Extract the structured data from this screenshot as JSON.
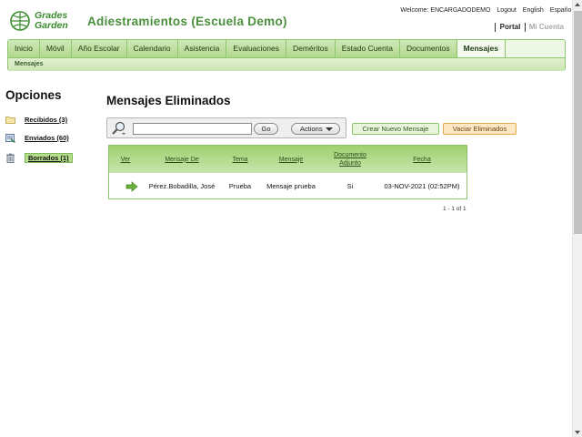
{
  "logo": {
    "line1": "Grades",
    "line2": "Garden",
    "icon": "grades-garden-logo"
  },
  "app_title": "Adiestramientos (Escuela Demo)",
  "top_links": {
    "welcome": "Welcome: ENCARGADODEMO",
    "logout": "Logout",
    "english": "English",
    "espanol": "Español"
  },
  "portal_links": {
    "portal": "Portal",
    "cuenta": "Mi Cuenta"
  },
  "nav": {
    "tabs": [
      {
        "label": "Inicio"
      },
      {
        "label": "Móvil"
      },
      {
        "label": "Año Escolar"
      },
      {
        "label": "Calendario"
      },
      {
        "label": "Asistencia"
      },
      {
        "label": "Evaluaciones"
      },
      {
        "label": "Deméritos"
      },
      {
        "label": "Estado Cuenta"
      },
      {
        "label": "Documentos"
      },
      {
        "label": "Mensajes",
        "active": true
      }
    ],
    "subnav": "Mensajes"
  },
  "sidebar": {
    "title": "Opciones",
    "items": [
      {
        "label": "Recibidos (3)",
        "icon": "folder-icon"
      },
      {
        "label": "Enviados (60)",
        "icon": "sent-icon"
      },
      {
        "label": "Borrados (1)",
        "icon": "trash-icon",
        "active": true
      }
    ]
  },
  "main": {
    "title": "Mensajes Eliminados",
    "search": {
      "placeholder": "",
      "value": "",
      "go_label": "Go",
      "actions_label": "Actions"
    },
    "buttons": {
      "new_message": "Crear Nuevo Mensaje",
      "empty_trash": "Vaciar Eliminados"
    },
    "table": {
      "columns": [
        "Ver",
        "Mensaje De",
        "Tema",
        "Mensaje",
        "Documento Adjunto",
        "Fecha"
      ],
      "rows": [
        {
          "ver_icon": "arrow-right-icon",
          "from": "Pérez.Bobadilla, José",
          "subject": "Prueba",
          "message": "Mensaje prueba",
          "attachment": "Si",
          "date": "03-NOV-2021 (02:52PM)"
        }
      ]
    },
    "pager": "1 - 1 of 1"
  },
  "colors": {
    "brand_green": "#4a8f3c",
    "tab_green": "#b2d88f",
    "accent_orange": "#fde7c4"
  }
}
